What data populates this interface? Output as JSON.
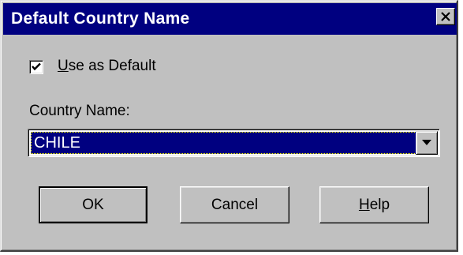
{
  "window": {
    "title": "Default Country Name"
  },
  "checkbox": {
    "label_accel": "U",
    "label_rest": "se as Default",
    "checked": true
  },
  "country": {
    "label": "Country Name:",
    "value": "CHILE"
  },
  "buttons": {
    "ok": "OK",
    "cancel": "Cancel",
    "help_accel": "H",
    "help_rest": "elp"
  },
  "colors": {
    "titlebar": "#000080",
    "face": "#c0c0c0",
    "selection": "#000080"
  },
  "icons": {
    "close": "close-icon",
    "check": "checkmark-icon",
    "dropdown": "chevron-down-icon"
  }
}
